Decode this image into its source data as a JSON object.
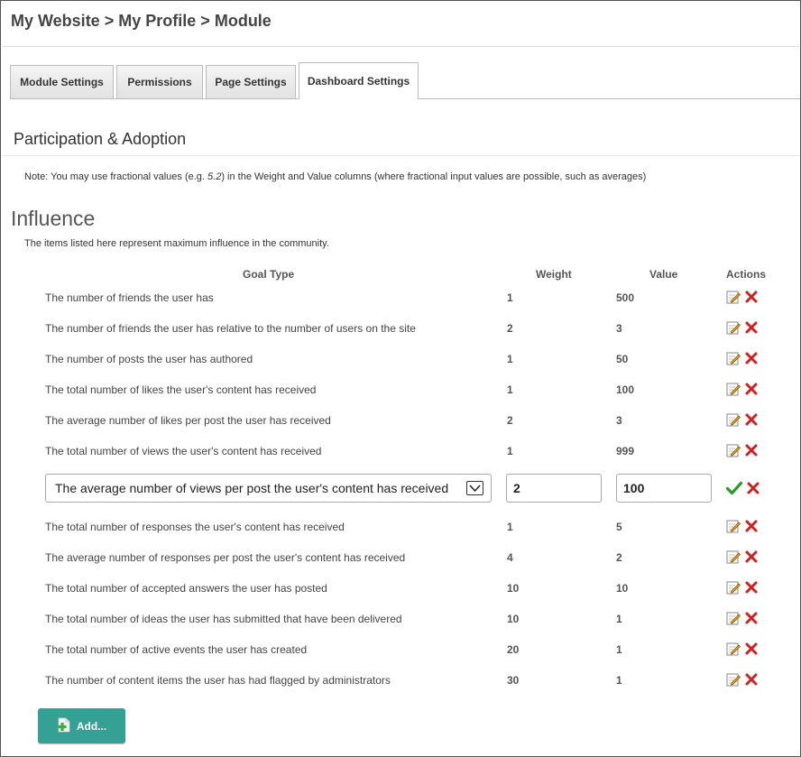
{
  "breadcrumb": {
    "parts": [
      "My Website",
      "My Profile",
      "Module"
    ],
    "separator": ">"
  },
  "tabs": [
    {
      "label": "Module Settings",
      "active": false
    },
    {
      "label": "Permissions",
      "active": false
    },
    {
      "label": "Page Settings",
      "active": false
    },
    {
      "label": "Dashboard Settings",
      "active": true
    }
  ],
  "section": {
    "title": "Participation & Adoption",
    "note_before": "Note: You may use fractional values (e.g. ",
    "note_example": "5.2",
    "note_after": ") in the Weight and Value columns (where fractional input values are possible, such as averages)"
  },
  "influence": {
    "heading": "Influence",
    "description": "The items listed here represent maximum influence in the community.",
    "columns": {
      "goal": "Goal Type",
      "weight": "Weight",
      "value": "Value",
      "actions": "Actions"
    },
    "rows": [
      {
        "goal": "The number of friends the user has",
        "weight": "1",
        "value": "500"
      },
      {
        "goal": "The number of friends the user has relative to the number of users on the site",
        "weight": "2",
        "value": "3"
      },
      {
        "goal": "The number of posts the user has authored",
        "weight": "1",
        "value": "50"
      },
      {
        "goal": "The total number of likes the user's content has received",
        "weight": "1",
        "value": "100"
      },
      {
        "goal": "The average number of likes per post the user has received",
        "weight": "2",
        "value": "3"
      },
      {
        "goal": "The total number of views the user's content has received",
        "weight": "1",
        "value": "999"
      },
      {
        "goal": "The total number of responses the user's content has received",
        "weight": "1",
        "value": "5"
      },
      {
        "goal": "The average number of responses per post the user's content has received",
        "weight": "4",
        "value": "2"
      },
      {
        "goal": "The total number of accepted answers the user has posted",
        "weight": "10",
        "value": "10"
      },
      {
        "goal": "The total number of ideas the user has submitted that have been delivered",
        "weight": "10",
        "value": "1"
      },
      {
        "goal": "The total number of active events the user has created",
        "weight": "20",
        "value": "1"
      },
      {
        "goal": "The number of content items the user has had flagged by administrators",
        "weight": "30",
        "value": "1"
      }
    ],
    "editing": {
      "goal": "The average number of views per post the user's content has received",
      "weight": "2",
      "value": "100"
    }
  },
  "add_button": {
    "label": "Add..."
  },
  "colors": {
    "accent": "#35a094",
    "delete": "#cc2222",
    "confirm": "#2a9a2a"
  },
  "icons": {
    "edit": "pencil-edit-icon",
    "delete": "delete-x-icon",
    "confirm": "checkmark-icon",
    "add": "add-page-icon",
    "dropdown": "chevron-down-icon"
  }
}
